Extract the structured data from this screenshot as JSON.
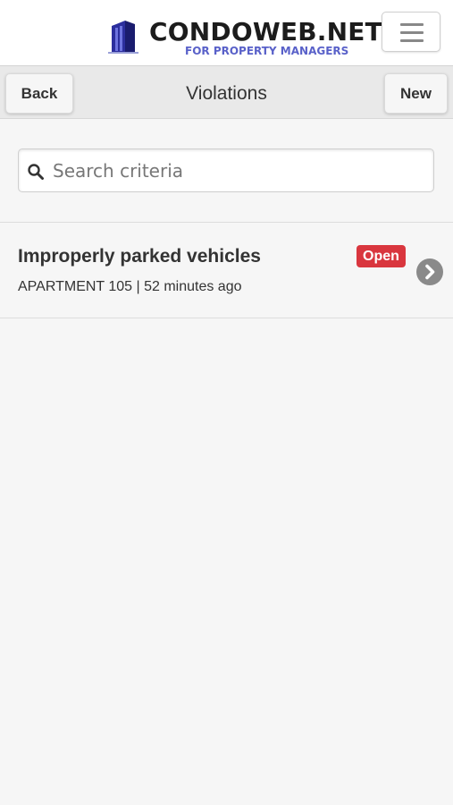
{
  "header": {
    "brand_title": "CONDOWEB.NET",
    "brand_subtitle": "FOR PROPERTY MANAGERS",
    "brand_color": "#5961c9",
    "menu_icon": "hamburger-menu-icon"
  },
  "toolbar": {
    "back_label": "Back",
    "title": "Violations",
    "new_label": "New"
  },
  "search": {
    "placeholder": "Search criteria",
    "value": "",
    "icon": "search-icon"
  },
  "violations": [
    {
      "title": "Improperly parked vehicles",
      "meta": "APARTMENT 105 | 52 minutes ago",
      "status": "Open",
      "status_color": "#d9363e",
      "icon": "chevron-right-icon"
    }
  ]
}
